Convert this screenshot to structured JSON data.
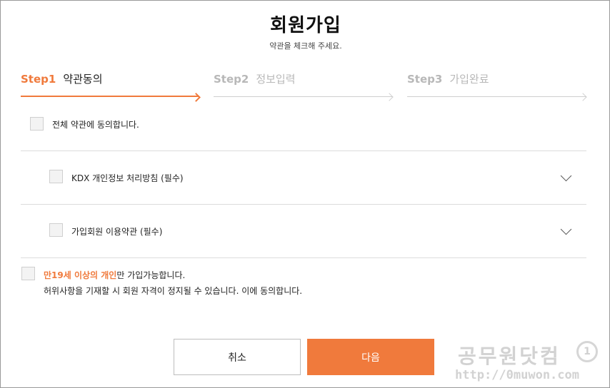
{
  "header": {
    "title": "회원가입",
    "subtitle": "약관을 체크해 주세요."
  },
  "steps": [
    {
      "num": "Step1",
      "name": "약관동의",
      "state": "active"
    },
    {
      "num": "Step2",
      "name": "정보입력",
      "state": "inactive"
    },
    {
      "num": "Step3",
      "name": "가입완료",
      "state": "inactive"
    }
  ],
  "agreements": {
    "all": {
      "label": "전체 약관에 동의합니다.",
      "checked": false
    },
    "items": [
      {
        "label": "KDX 개인정보 처리방침 (필수)",
        "checked": false,
        "expandable": true
      },
      {
        "label": "가입회원 이용약관 (필수)",
        "checked": false,
        "expandable": true
      }
    ]
  },
  "age_notice": {
    "highlight": "만19세 이상의 개인",
    "rest": "만 가입가능합니다.",
    "line2": "허위사항을 기재할 시 회원 자격이 정지될 수 있습니다. 이에 동의합니다.",
    "checked": false
  },
  "buttons": {
    "cancel": "취소",
    "next": "다음"
  },
  "watermark": {
    "text": "공무원닷컴",
    "url": "http://0muwon.com",
    "logo": "1"
  },
  "colors": {
    "accent": "#f07a3c",
    "inactive": "#b8b8b8",
    "divider": "#dcdcdc"
  }
}
